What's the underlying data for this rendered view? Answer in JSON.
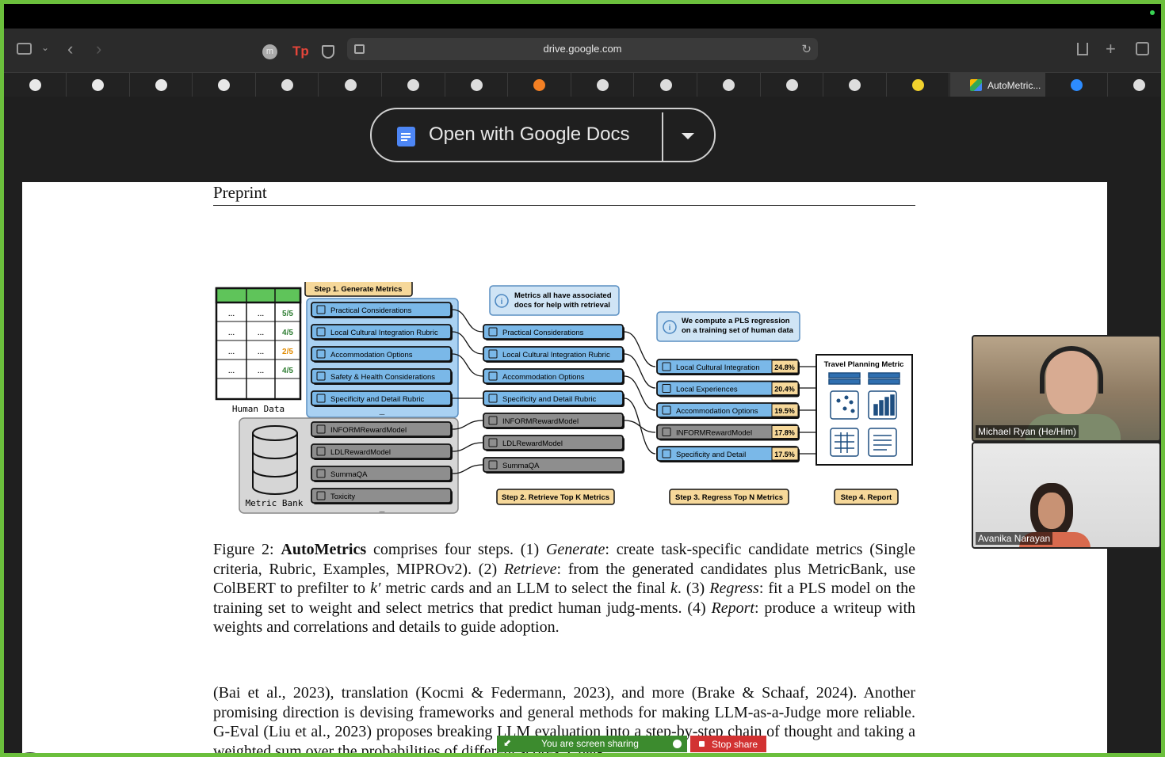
{
  "browser": {
    "url": "drive.google.com",
    "active_tab_label": "AutoMetric...",
    "tab_icons": [
      "github-icon",
      "github-icon",
      "github-icon",
      "github-icon",
      "chrome-icon",
      "google-cloud-icon",
      "chrome-icon",
      "chrome-icon",
      "stack-overflow-icon",
      "box-icon",
      "notion-icon",
      "chrome-icon",
      "g-icon",
      "document-icon",
      "smiley-icon",
      "google-drive-icon",
      "zoom-icon",
      "document-icon"
    ]
  },
  "viewer": {
    "open_with_label": "Open with Google Docs"
  },
  "document": {
    "header": "Preprint",
    "figure": {
      "step1": "Step 1. Generate Metrics",
      "step2": "Step 2. Retrieve Top K Metrics",
      "step3": "Step 3. Regress Top N Metrics",
      "step4": "Step 4. Report",
      "human_data_label": "Human Data",
      "metric_bank_label": "Metric Bank",
      "table_scores": [
        "5/5",
        "4/5",
        "2/5",
        "4/5"
      ],
      "table_dots": "...",
      "more": "...",
      "generated_metrics": [
        "Practical Considerations",
        "Local Cultural Integration Rubric",
        "Accommodation Options",
        "Safety & Health Considerations",
        "Specificity and Detail Rubric"
      ],
      "bank_metrics": [
        "INFORMRewardModel",
        "LDLRewardModel",
        "SummaQA",
        "Toxicity"
      ],
      "retrieved_metrics": [
        "Practical Considerations",
        "Local Cultural Integration Rubric",
        "Accommodation Options",
        "Specificity and Detail Rubric",
        "INFORMRewardModel",
        "LDLRewardModel",
        "SummaQA"
      ],
      "regressed_metrics": [
        {
          "name": "Local Cultural Integration",
          "weight": "24.8%"
        },
        {
          "name": "Local Experiences",
          "weight": "20.4%"
        },
        {
          "name": "Accommodation Options",
          "weight": "19.5%"
        },
        {
          "name": "INFORMRewardModel",
          "weight": "17.8%"
        },
        {
          "name": "Specificity and Detail",
          "weight": "17.5%"
        }
      ],
      "note1": [
        "Metrics all have associated",
        "docs for help with retrieval"
      ],
      "note2": [
        "We compute a PLS regression",
        "on a training set of human data"
      ],
      "report_title": "Travel Planning Metric"
    },
    "caption": "Figure 2: AutoMetrics comprises four steps. (1) Generate: create task-specific candidate metrics (Single criteria, Rubric, Examples, MIPROv2). (2) Retrieve: from the generated candidates plus MetricBank, use ColBERT to prefilter to k′ metric cards and an LLM to select the final k. (3) Regress: fit a PLS model on the training set to weight and select metrics that predict human judgments. (4) Report: produce a writeup with weights and correlations and details to guide adoption.",
    "caption_parts": {
      "lead": "Figure 2: ",
      "bold": "AutoMetrics",
      "a": " comprises four steps. (1) ",
      "i1": "Generate",
      "b": ": create task-specific candidate metrics (Single criteria, Rubric, Examples, MIPROv2). (2) ",
      "i2": "Retrieve",
      "c": ": from the generated candidates plus MetricBank, use ColBERT to prefilter to ",
      "m1": "k′",
      "d": " metric cards and an LLM to select the final ",
      "m2": "k",
      "e": ". (3) ",
      "i3": "Regress",
      "f": ": fit a PLS model on the training set to weight and select metrics that predict human judg-ments. (4) ",
      "i4": "Report",
      "g": ": produce a writeup with weights and correlations and details to guide adoption."
    },
    "paragraph": "(Bai et al., 2023), translation (Kocmi & Federmann, 2023), and more (Brake & Schaaf, 2024). Another promising direction is devising frameworks and general methods for making LLM-as-a-Judge more reliable. G-Eval (Liu et al., 2023) proposes breaking LLM evaluation into a step-by-step chain of thought and taking a weighted sum over the probabilities of different scores. Chat-"
  },
  "meeting": {
    "participants": [
      "Michael Ryan (He/Him)",
      "Avanika Narayan"
    ],
    "sharing_text": "You are screen sharing",
    "stop_share_label": "Stop share"
  },
  "colors": {
    "blue_box": "#7ab8e8",
    "gray_box": "#8e8e8e",
    "step_label": "#f6d89a",
    "note": "#cfe4f5",
    "share_green": "#3c8b2e",
    "stop_red": "#d23232"
  }
}
